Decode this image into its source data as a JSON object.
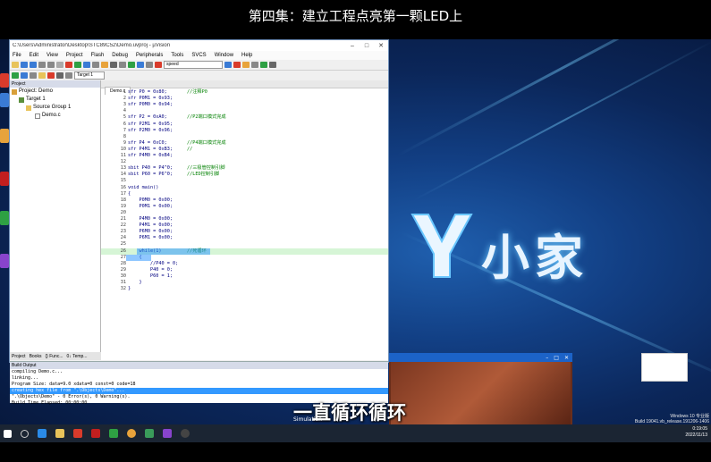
{
  "video": {
    "title": "第四集：建立工程点亮第一颗LED上",
    "subtitle": "一直循环循环"
  },
  "ide": {
    "title": "C:\\Users\\Administrator\\Desktop\\STC89C52\\Demo.uvproj - µVision",
    "menu": [
      "File",
      "Edit",
      "View",
      "Project",
      "Flash",
      "Debug",
      "Peripherals",
      "Tools",
      "SVCS",
      "Window",
      "Help"
    ],
    "target_combo": "Target 1",
    "search_combo": "speed",
    "project_header": "Project",
    "tree": [
      "Project: Demo",
      "Target 1",
      "Source Group 1",
      "Demo.c"
    ],
    "project_tabs": [
      "Project",
      "Books",
      "{} Func...",
      "0↓ Temp..."
    ],
    "editor_tab": "Demo.c",
    "code_lines": [
      {
        "n": "1",
        "code": "sfr P0 = 0x80;",
        "comment": "//注释P0"
      },
      {
        "n": "2",
        "code": "sfr P0M1 = 0x93;",
        "comment": ""
      },
      {
        "n": "3",
        "code": "sfr P0M0 = 0x94;",
        "comment": ""
      },
      {
        "n": "4",
        "code": "",
        "comment": ""
      },
      {
        "n": "5",
        "code": "sfr P2 = 0xA0;",
        "comment": "//P2端口模式完成"
      },
      {
        "n": "6",
        "code": "sfr P2M1 = 0x95;",
        "comment": ""
      },
      {
        "n": "7",
        "code": "sfr P2M0 = 0x96;",
        "comment": ""
      },
      {
        "n": "8",
        "code": "",
        "comment": ""
      },
      {
        "n": "9",
        "code": "sfr P4 = 0xC0;",
        "comment": "//P4端口模式完成"
      },
      {
        "n": "10",
        "code": "sfr P4M1 = 0xB3;",
        "comment": "//"
      },
      {
        "n": "11",
        "code": "sfr P4M0 = 0xB4;",
        "comment": ""
      },
      {
        "n": "12",
        "code": "",
        "comment": ""
      },
      {
        "n": "13",
        "code": "sbit P40 = P4^0;",
        "comment": "//三极管控制引脚"
      },
      {
        "n": "14",
        "code": "sbit P60 = P6^0;",
        "comment": "//LED控制引脚"
      },
      {
        "n": "15",
        "code": "",
        "comment": ""
      },
      {
        "n": "16",
        "code": "void main()",
        "comment": ""
      },
      {
        "n": "17",
        "code": "{",
        "comment": ""
      },
      {
        "n": "18",
        "code": "    P0M0 = 0x00;",
        "comment": ""
      },
      {
        "n": "19",
        "code": "    P0M1 = 0x00;",
        "comment": ""
      },
      {
        "n": "20",
        "code": "",
        "comment": ""
      },
      {
        "n": "21",
        "code": "    P4M0 = 0x00;",
        "comment": ""
      },
      {
        "n": "22",
        "code": "    P4M1 = 0x00;",
        "comment": ""
      },
      {
        "n": "23",
        "code": "    P6M0 = 0x00;",
        "comment": ""
      },
      {
        "n": "24",
        "code": "    P6M1 = 0x00;",
        "comment": ""
      },
      {
        "n": "25",
        "code": "",
        "comment": ""
      },
      {
        "n": "26",
        "code": "    while(1)",
        "comment": "//死循环"
      },
      {
        "n": "27",
        "code": "    {",
        "comment": ""
      },
      {
        "n": "28",
        "code": "        //P40 = 0;",
        "comment": ""
      },
      {
        "n": "29",
        "code": "        P40 = 0;",
        "comment": ""
      },
      {
        "n": "30",
        "code": "        P60 = 1;",
        "comment": ""
      },
      {
        "n": "31",
        "code": "    }",
        "comment": ""
      },
      {
        "n": "32",
        "code": "}",
        "comment": ""
      }
    ],
    "build_header": "Build Output",
    "build_lines": [
      "compiling Demo.c...",
      "linking...",
      "Program Size: data=9.0 xdata=0 const=0 code=18",
      "creating hex file from \".\\Objects\\Demo\"...",
      "\".\\Objects\\Demo\" - 0 Error(s), 0 Warning(s).",
      "Build Time Elapsed:  00:00:00"
    ],
    "status": "Simulation"
  },
  "brand": {
    "text": "小家"
  },
  "tray": {
    "line1": "Windows 10 专业版",
    "line2": "Build 19041.vb_release.191206-1406",
    "time": "0:19:05",
    "date": "2022/11/13"
  },
  "colors": {
    "accent": "#3399ff",
    "desktop": "#123f84",
    "taskbar": "#1b2533",
    "comment": "#008000",
    "keyword": "#000080"
  }
}
